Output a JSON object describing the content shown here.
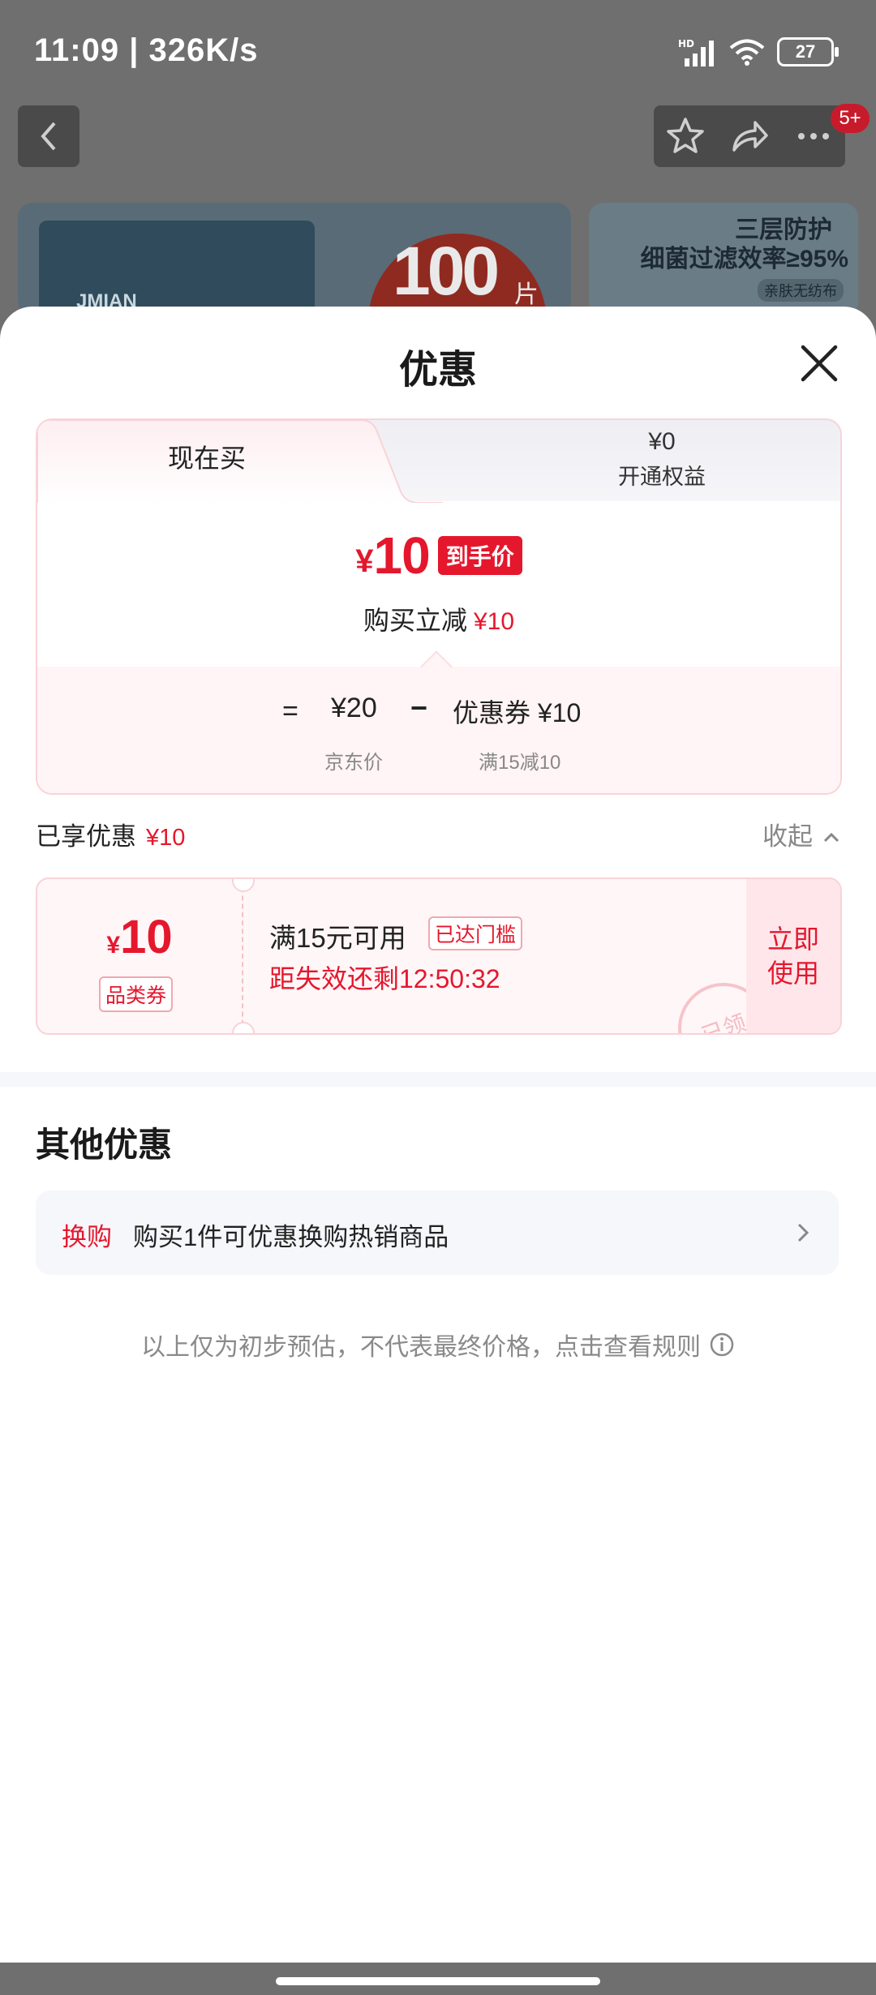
{
  "status_bar": {
    "time": "11:09 | 326K/s",
    "battery": "27"
  },
  "product": {
    "image1_brand": "JMIAN",
    "image1_count": "100",
    "image1_unit": "片",
    "image2_line1": "三层防护",
    "image2_line2": "细菌过滤效率≥95%",
    "image2_line3": "亲肤无纺布"
  },
  "top_bar": {
    "cart_badge": "5+"
  },
  "sheet": {
    "title": "优惠",
    "tabs": {
      "now": "现在买",
      "equity_price": "¥0",
      "equity_label": "开通权益"
    },
    "price": {
      "symbol": "¥",
      "value": "10",
      "tag": "到手价",
      "reduce_label": "购买立减",
      "reduce_amount": "¥10"
    },
    "formula": {
      "eq": "=",
      "jd_price": "¥20",
      "minus": "−",
      "coupon": "优惠券 ¥10",
      "jd_label": "京东价",
      "coupon_label": "满15减10"
    },
    "enjoyed": {
      "label": "已享优惠",
      "amount": "¥10",
      "collapse": "收起"
    },
    "coupon": {
      "symbol": "¥",
      "value": "10",
      "category": "品类券",
      "condition": "满15元可用",
      "reached": "已达门槛",
      "expire": "距失效还剩12:50:32",
      "use_button": "立即使用",
      "stamp": "已领"
    },
    "other": {
      "title": "其他优惠",
      "exchange_tag": "换购",
      "exchange_text": "购买1件可优惠换购热销商品"
    },
    "disclaimer": "以上仅为初步预估，不代表最终价格，点击查看规则"
  }
}
